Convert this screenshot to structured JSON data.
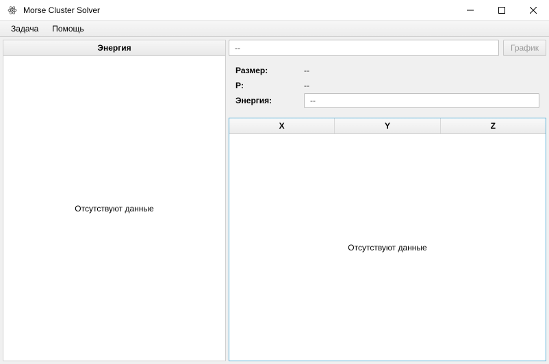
{
  "window": {
    "title": "Morse Cluster Solver"
  },
  "menu": {
    "task": "Задача",
    "help": "Помощь"
  },
  "left": {
    "header": "Энергия",
    "empty": "Отсутствуют данные"
  },
  "right": {
    "top_input_value": "--",
    "graph_button": "График",
    "size_label": "Размер:",
    "size_value": "--",
    "p_label": "P:",
    "p_value": "--",
    "energy_label": "Энергия:",
    "energy_value": "--",
    "col_x": "X",
    "col_y": "Y",
    "col_z": "Z",
    "table_empty": "Отсутствуют данные"
  }
}
